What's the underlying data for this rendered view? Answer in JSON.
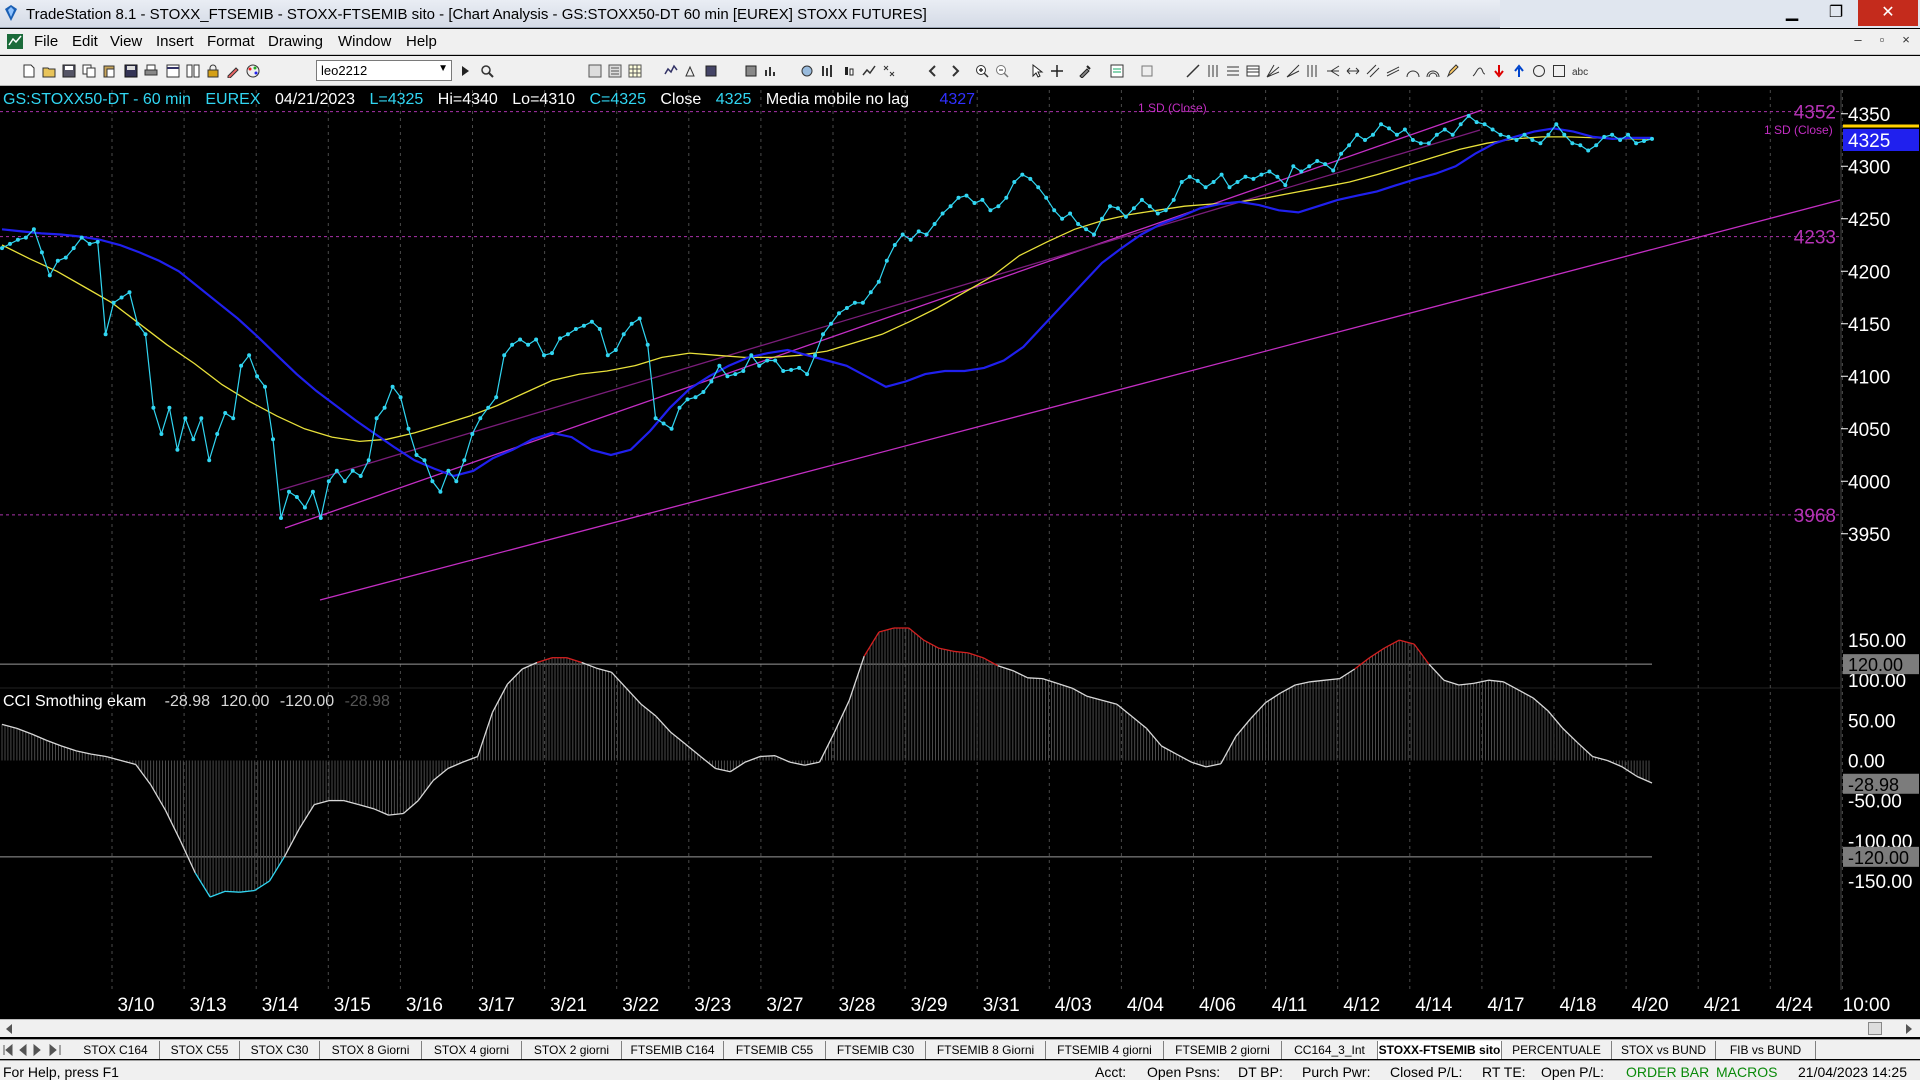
{
  "window": {
    "title": "TradeStation 8.1 - STOXX_FTSEMIB - STOXX-FTSEMIB sito - [Chart Analysis - GS:STOXX50-DT  60 min  [EUREX] STOXX FUTURES]",
    "minimize": "▁",
    "restore": "❐",
    "close": "✕"
  },
  "menu": [
    "File",
    "Edit",
    "View",
    "Insert",
    "Format",
    "Drawing",
    "Window",
    "Help"
  ],
  "mdi_controls": [
    "–",
    "▫",
    "×"
  ],
  "toolbar": {
    "workspace_value": "leo2212"
  },
  "chart_info": {
    "symbol": "GS:STOXX50-DT - 60 min",
    "exchange": "EUREX",
    "date": "04/21/2023",
    "last": "L=4325",
    "high": "Hi=4340",
    "low": "Lo=4310",
    "close": "C=4325",
    "close_label": "Close",
    "close_value": "4325",
    "ma_label": "Media mobile no lag",
    "ma_value": "4327"
  },
  "cci_info": {
    "label": "CCI Smothing ekam",
    "value": "-28.98",
    "upper": "120.00",
    "lower": "-120.00",
    "value2": "-28.98"
  },
  "chart_data": [
    {
      "type": "line",
      "axis_labels": [
        "4350",
        "4300",
        "4250",
        "4200",
        "4150",
        "4100",
        "4050",
        "4000",
        "3950"
      ],
      "price_axis_marker": "4325",
      "levels": [
        {
          "label": "4352",
          "value": 4352
        },
        {
          "label": "4233",
          "value": 4233
        },
        {
          "label": "3968",
          "value": 3968
        }
      ],
      "channel_labels": [
        "1 SD (Close)",
        "1 SD (Close)"
      ],
      "x_labels": [
        "3/10",
        "3/13",
        "3/14",
        "3/15",
        "3/16",
        "3/17",
        "3/21",
        "3/22",
        "3/23",
        "3/27",
        "3/28",
        "3/29",
        "3/31",
        "4/03",
        "4/04",
        "4/06",
        "4/11",
        "4/12",
        "4/14",
        "4/17",
        "4/18",
        "4/20",
        "4/21",
        "4/24",
        "10:00"
      ],
      "ylim": [
        3925,
        4365
      ],
      "series": [
        {
          "color": "#31d6f2",
          "values": [
            4222,
            4226,
            4230,
            4232,
            4240,
            4218,
            4196,
            4210,
            4213,
            4222,
            4232,
            4226,
            4228,
            4140,
            4170,
            4175,
            4180,
            4150,
            4140,
            4070,
            4045,
            4070,
            4030,
            4060,
            4040,
            4060,
            4020,
            4045,
            4065,
            4060,
            4110,
            4120,
            4100,
            4090,
            4040,
            3965,
            3990,
            3985,
            3975,
            3990,
            3965,
            4000,
            4010,
            4000,
            4010,
            4005,
            4020,
            4060,
            4070,
            4090,
            4080,
            4050,
            4025,
            4020,
            4000,
            3990,
            4010,
            4000,
            4020,
            4045,
            4060,
            4070,
            4080,
            4120,
            4130,
            4135,
            4130,
            4135,
            4120,
            4122,
            4136,
            4140,
            4145,
            4148,
            4152,
            4145,
            4120,
            4125,
            4140,
            4150,
            4155,
            4130,
            4060,
            4055,
            4050,
            4070,
            4078,
            4080,
            4085,
            4095,
            4110,
            4100,
            4102,
            4105,
            4120,
            4110,
            4115,
            4115,
            4105,
            4106,
            4108,
            4102,
            4120,
            4140,
            4150,
            4160,
            4165,
            4170,
            4170,
            4180,
            4190,
            4210,
            4225,
            4235,
            4230,
            4238,
            4235,
            4245,
            4255,
            4262,
            4270,
            4272,
            4265,
            4268,
            4258,
            4262,
            4270,
            4285,
            4292,
            4288,
            4280,
            4270,
            4258,
            4250,
            4255,
            4245,
            4240,
            4235,
            4250,
            4262,
            4260,
            4252,
            4260,
            4268,
            4262,
            4255,
            4258,
            4268,
            4285,
            4290,
            4286,
            4280,
            4285,
            4292,
            4280,
            4285,
            4290,
            4288,
            4292,
            4295,
            4290,
            4282,
            4300,
            4295,
            4300,
            4305,
            4302,
            4296,
            4312,
            4320,
            4330,
            4325,
            4330,
            4340,
            4336,
            4330,
            4335,
            4325,
            4322,
            4322,
            4330,
            4335,
            4330,
            4340,
            4348,
            4342,
            4340,
            4335,
            4330,
            4328,
            4325,
            4330,
            4325,
            4322,
            4330,
            4340,
            4330,
            4322,
            4320,
            4315,
            4320,
            4328,
            4330,
            4325,
            4330,
            4322,
            4324,
            4326
          ],
          "markers": true
        },
        {
          "color": "#2020ee",
          "values": [
            4240,
            4238,
            4236,
            4235,
            4233,
            4230,
            4225,
            4218,
            4210,
            4200,
            4185,
            4170,
            4155,
            4138,
            4120,
            4102,
            4086,
            4072,
            4058,
            4045,
            4032,
            4020,
            4012,
            4005,
            4010,
            4022,
            4030,
            4040,
            4046,
            4042,
            4030,
            4025,
            4030,
            4048,
            4070,
            4088,
            4100,
            4110,
            4118,
            4122,
            4125,
            4120,
            4115,
            4110,
            4100,
            4090,
            4095,
            4102,
            4105,
            4105,
            4108,
            4115,
            4128,
            4148,
            4168,
            4188,
            4208,
            4222,
            4235,
            4245,
            4252,
            4260,
            4264,
            4266,
            4263,
            4258,
            4256,
            4262,
            4268,
            4272,
            4276,
            4282,
            4288,
            4293,
            4300,
            4312,
            4322,
            4328,
            4333,
            4336,
            4333,
            4328,
            4326,
            4327,
            4327
          ],
          "markers": false
        },
        {
          "color": "#e8e03a",
          "values": [
            4225,
            4212,
            4200,
            4185,
            4170,
            4150,
            4130,
            4112,
            4092,
            4076,
            4062,
            4050,
            4042,
            4038,
            4040,
            4046,
            4054,
            4062,
            4072,
            4084,
            4096,
            4102,
            4105,
            4110,
            4118,
            4122,
            4120,
            4118,
            4118,
            4120,
            4124,
            4132,
            4140,
            4152,
            4165,
            4180,
            4195,
            4215,
            4228,
            4240,
            4248,
            4254,
            4258,
            4262,
            4264,
            4266,
            4270,
            4275,
            4280,
            4285,
            4292,
            4300,
            4308,
            4316,
            4322,
            4326,
            4328,
            4328,
            4327,
            4326,
            4326
          ],
          "markers": false
        }
      ]
    },
    {
      "type": "line",
      "axis_labels": [
        "150.00",
        "100.00",
        "50.00",
        "0.00",
        "-50.00",
        "-100.00",
        "-150.00"
      ],
      "markers": [
        "120.00",
        "-28.98",
        "-120.00"
      ],
      "levels": [
        120,
        -120
      ],
      "ylim": [
        -180,
        175
      ],
      "series": [
        {
          "color": "#d8d8d8",
          "values": [
            45,
            40,
            33,
            25,
            18,
            12,
            8,
            5,
            0,
            -5,
            -30,
            -62,
            -100,
            -140,
            -170,
            -163,
            -164,
            -162,
            -150,
            -120,
            -85,
            -55,
            -50,
            -50,
            -55,
            -60,
            -68,
            -66,
            -50,
            -25,
            -10,
            -2,
            5,
            60,
            95,
            114,
            122,
            128,
            128,
            122,
            115,
            110,
            90,
            70,
            55,
            35,
            20,
            5,
            -10,
            -14,
            -2,
            5,
            6,
            -2,
            -6,
            -2,
            35,
            75,
            130,
            160,
            165,
            165,
            150,
            140,
            136,
            134,
            128,
            118,
            112,
            103,
            102,
            96,
            90,
            80,
            75,
            70,
            55,
            40,
            18,
            8,
            -2,
            -8,
            -4,
            30,
            52,
            72,
            84,
            94,
            98,
            100,
            102,
            114,
            128,
            140,
            150,
            145,
            120,
            100,
            94,
            96,
            100,
            98,
            88,
            78,
            62,
            40,
            22,
            5,
            0,
            -8,
            -20,
            -28
          ]
        }
      ]
    }
  ]
}
